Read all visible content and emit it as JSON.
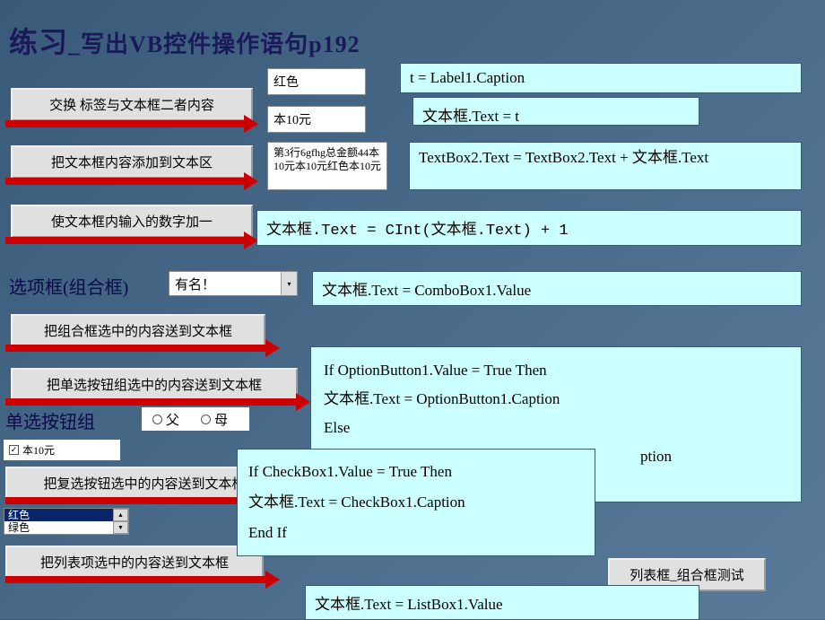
{
  "title_main": "练习",
  "title_sub": "_写出VB控件操作语句p192",
  "buttons": {
    "swap": "交换  标签与文本框二者内容",
    "append": "把文本框内容添加到文本区",
    "inc": "使文本框内输入的数字加一",
    "combo_send": "把组合框选中的内容送到文本框",
    "radio_send": "把单选按钮组选中的内容送到文本框",
    "check_send": "把复选按钮选中的内容送到文本框",
    "list_send": "把列表项选中的内容送到文本框",
    "test": "列表框_组合框测试"
  },
  "inputs": {
    "red": "红色",
    "price": "本10元",
    "multi": "第3行6gfhg总金额44本10元本10元红色本10元"
  },
  "code": {
    "c1": "t = Label1.Caption",
    "c2": "文本框.Text =  t",
    "c3": "TextBox2.Text = TextBox2.Text + 文本框.Text",
    "c4": "文本框.Text = CInt(文本框.Text) + 1",
    "c5": "文本框.Text = ComboBox1.Value",
    "c6a": "If OptionButton1.Value = True Then",
    "c6b": "文本框.Text = OptionButton1.Caption",
    "c6c": "Else",
    "c6d": "ption",
    "c7a": "If CheckBox1.Value = True Then",
    "c7b": "文本框.Text = CheckBox1.Caption",
    "c7c": "End If",
    "c8": "文本框.Text = ListBox1.Value"
  },
  "labels": {
    "combo_label": "选项框(组合框)",
    "radio_label": "单选按钮组"
  },
  "combo_value": "有名！",
  "radio": {
    "opt1": "父",
    "opt2": "母"
  },
  "checkbox": {
    "item": "本10元"
  },
  "listbox": {
    "row1": "红色",
    "row2": "绿色"
  }
}
